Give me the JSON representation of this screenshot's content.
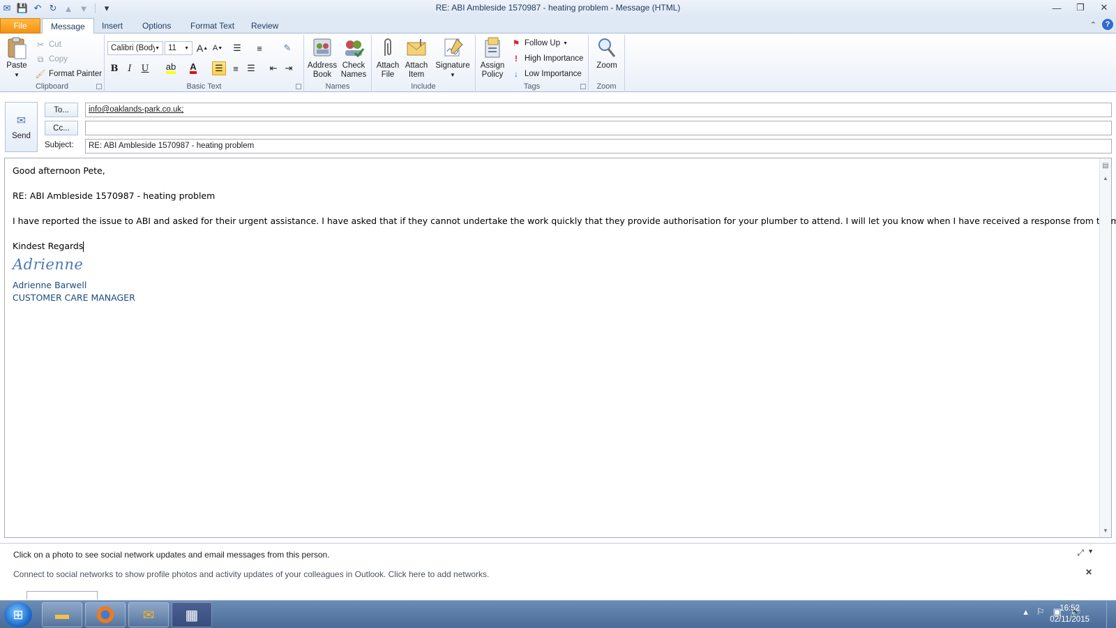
{
  "window": {
    "title": "RE: ABI Ambleside 1570987 - heating problem  -  Message (HTML)",
    "controls": {
      "minimize": "—",
      "restore": "❐",
      "close": "✕"
    }
  },
  "quick_access": {
    "save": "💾",
    "undo": "↶",
    "redo": "↻",
    "up": "▲",
    "down": "▼",
    "customize": "▾"
  },
  "tabs": {
    "file": "File",
    "message": "Message",
    "insert": "Insert",
    "options": "Options",
    "format_text": "Format Text",
    "review": "Review"
  },
  "ribbon": {
    "clipboard": {
      "label": "Clipboard",
      "paste": "Paste",
      "cut": "Cut",
      "copy": "Copy",
      "format_painter": "Format Painter"
    },
    "basic_text": {
      "label": "Basic Text",
      "font": "Calibri (Body)",
      "size": "11",
      "bold": "B",
      "italic": "I",
      "underline": "U"
    },
    "names": {
      "label": "Names",
      "address_book_1": "Address",
      "address_book_2": "Book",
      "check_names_1": "Check",
      "check_names_2": "Names"
    },
    "include": {
      "label": "Include",
      "attach_file_1": "Attach",
      "attach_file_2": "File",
      "attach_item_1": "Attach",
      "attach_item_2": "Item",
      "signature": "Signature"
    },
    "tags": {
      "label": "Tags",
      "assign_policy_1": "Assign",
      "assign_policy_2": "Policy",
      "follow_up": "Follow Up",
      "high_importance": "High Importance",
      "low_importance": "Low Importance"
    },
    "zoom": {
      "label": "Zoom",
      "zoom": "Zoom"
    }
  },
  "header": {
    "send": "Send",
    "to_button": "To...",
    "cc_button": "Cc...",
    "subject_label": "Subject:",
    "to_value": "info@oaklands-park.co.uk;",
    "cc_value": "",
    "subject_value": "RE: ABI Ambleside 1570987 - heating problem"
  },
  "body": {
    "greeting": "Good afternoon Pete,",
    "re_line": "RE: ABI Ambleside 1570987 - heating problem",
    "paragraph": "I have reported the issue to ABI and asked for their urgent assistance.  I have asked that if they cannot undertake the work quickly that they provide authorisation for your plumber to attend.  I will let you know when I have received a response from them.",
    "closing": "Kindest Regards",
    "signature_script": "Adrienne",
    "sig_name": "Adrienne Barwell",
    "sig_title": "CUSTOMER CARE MANAGER"
  },
  "social_pane": {
    "headline": "Click on a photo to see social network updates and email messages from this person.",
    "connect": "Connect to social networks to show profile photos and activity updates of your colleagues in Outlook. Click here to add networks."
  },
  "taskbar": {
    "time": "16:52",
    "date": "02/11/2015"
  },
  "colors": {
    "file_tab": "#f49212",
    "signature_blue": "#1f497d",
    "ribbon_bg": "#eaf0f8",
    "taskbar": "#4a6b97"
  }
}
